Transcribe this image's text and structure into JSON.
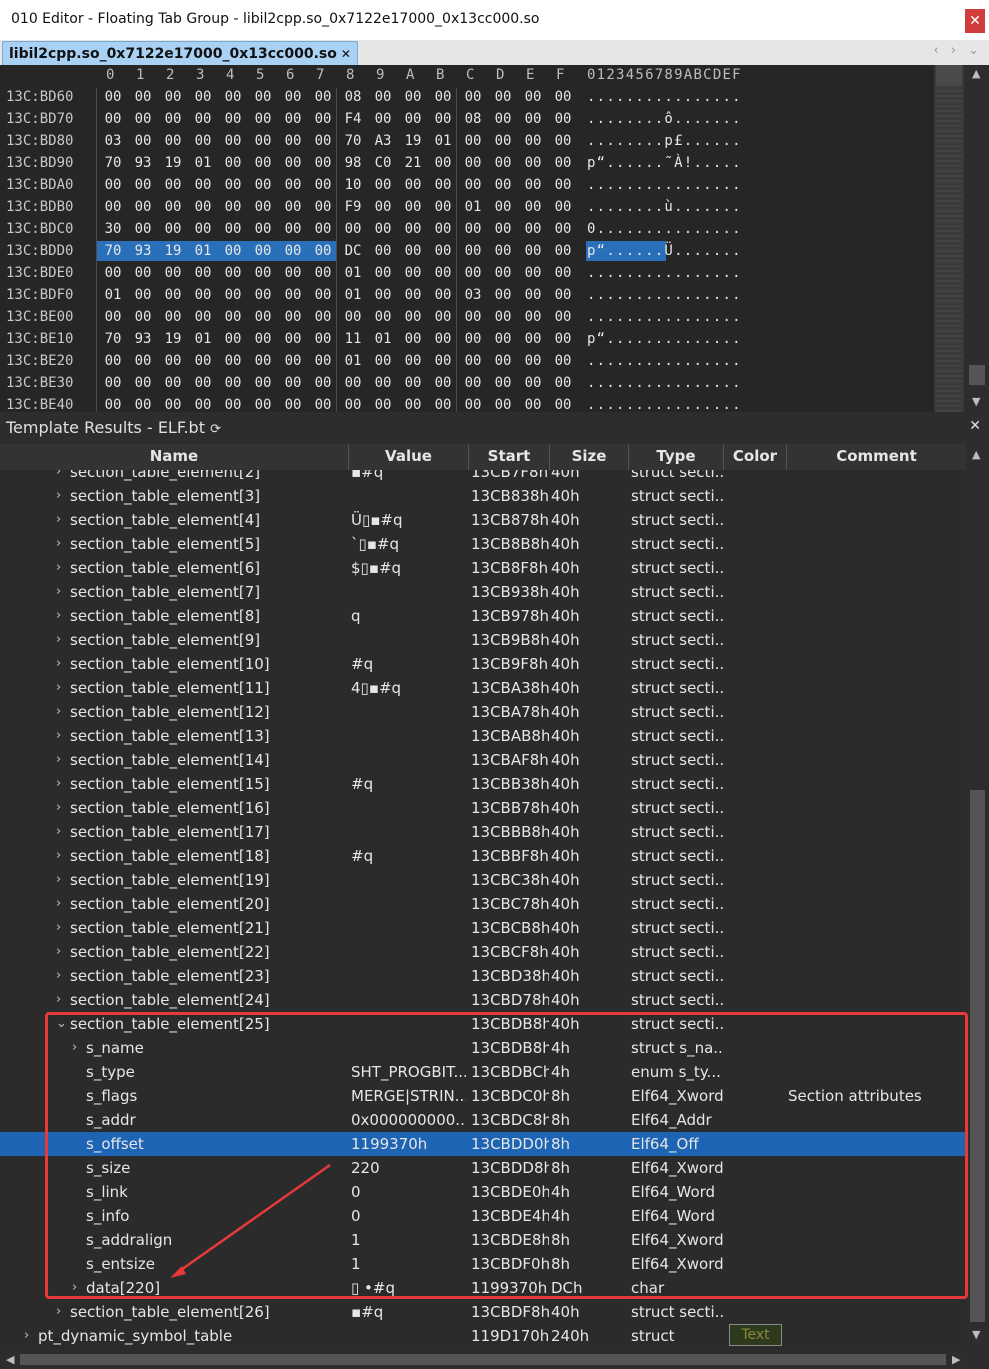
{
  "window": {
    "title": "010 Editor - Floating Tab Group - libil2cpp.so_0x7122e17000_0x13cc000.so",
    "close_glyph": "✕"
  },
  "tabs": [
    {
      "label": "libil2cpp.so_0x7122e17000_0x13cc000.so",
      "close": "✕"
    }
  ],
  "tab_nav": "‹ › ⌄",
  "hex": {
    "column_headers": [
      "0",
      "1",
      "2",
      "3",
      "4",
      "5",
      "6",
      "7",
      "8",
      "9",
      "A",
      "B",
      "C",
      "D",
      "E",
      "F"
    ],
    "ascii_header": "0123456789ABCDEF",
    "rows": [
      {
        "addr": "13C:BD60",
        "bytes": [
          "00",
          "00",
          "00",
          "00",
          "00",
          "00",
          "00",
          "00",
          "08",
          "00",
          "00",
          "00",
          "00",
          "00",
          "00",
          "00"
        ],
        "ascii": "................"
      },
      {
        "addr": "13C:BD70",
        "bytes": [
          "00",
          "00",
          "00",
          "00",
          "00",
          "00",
          "00",
          "00",
          "F4",
          "00",
          "00",
          "00",
          "08",
          "00",
          "00",
          "00"
        ],
        "ascii": "........ô......."
      },
      {
        "addr": "13C:BD80",
        "bytes": [
          "03",
          "00",
          "00",
          "00",
          "00",
          "00",
          "00",
          "00",
          "70",
          "A3",
          "19",
          "01",
          "00",
          "00",
          "00",
          "00"
        ],
        "ascii": "........p£......"
      },
      {
        "addr": "13C:BD90",
        "bytes": [
          "70",
          "93",
          "19",
          "01",
          "00",
          "00",
          "00",
          "00",
          "98",
          "C0",
          "21",
          "00",
          "00",
          "00",
          "00",
          "00"
        ],
        "ascii": "p“......˜À!....."
      },
      {
        "addr": "13C:BDA0",
        "bytes": [
          "00",
          "00",
          "00",
          "00",
          "00",
          "00",
          "00",
          "00",
          "10",
          "00",
          "00",
          "00",
          "00",
          "00",
          "00",
          "00"
        ],
        "ascii": "................"
      },
      {
        "addr": "13C:BDB0",
        "bytes": [
          "00",
          "00",
          "00",
          "00",
          "00",
          "00",
          "00",
          "00",
          "F9",
          "00",
          "00",
          "00",
          "01",
          "00",
          "00",
          "00"
        ],
        "ascii": "........ù......."
      },
      {
        "addr": "13C:BDC0",
        "bytes": [
          "30",
          "00",
          "00",
          "00",
          "00",
          "00",
          "00",
          "00",
          "00",
          "00",
          "00",
          "00",
          "00",
          "00",
          "00",
          "00"
        ],
        "ascii": "0..............."
      },
      {
        "addr": "13C:BDD0",
        "bytes": [
          "70",
          "93",
          "19",
          "01",
          "00",
          "00",
          "00",
          "00",
          "DC",
          "00",
          "00",
          "00",
          "00",
          "00",
          "00",
          "00"
        ],
        "ascii": "p“......Ü.......",
        "selected": true
      },
      {
        "addr": "13C:BDE0",
        "bytes": [
          "00",
          "00",
          "00",
          "00",
          "00",
          "00",
          "00",
          "00",
          "01",
          "00",
          "00",
          "00",
          "00",
          "00",
          "00",
          "00"
        ],
        "ascii": "................"
      },
      {
        "addr": "13C:BDF0",
        "bytes": [
          "01",
          "00",
          "00",
          "00",
          "00",
          "00",
          "00",
          "00",
          "01",
          "00",
          "00",
          "00",
          "03",
          "00",
          "00",
          "00"
        ],
        "ascii": "................"
      },
      {
        "addr": "13C:BE00",
        "bytes": [
          "00",
          "00",
          "00",
          "00",
          "00",
          "00",
          "00",
          "00",
          "00",
          "00",
          "00",
          "00",
          "00",
          "00",
          "00",
          "00"
        ],
        "ascii": "................"
      },
      {
        "addr": "13C:BE10",
        "bytes": [
          "70",
          "93",
          "19",
          "01",
          "00",
          "00",
          "00",
          "00",
          "11",
          "01",
          "00",
          "00",
          "00",
          "00",
          "00",
          "00"
        ],
        "ascii": "p“.............."
      },
      {
        "addr": "13C:BE20",
        "bytes": [
          "00",
          "00",
          "00",
          "00",
          "00",
          "00",
          "00",
          "00",
          "01",
          "00",
          "00",
          "00",
          "00",
          "00",
          "00",
          "00"
        ],
        "ascii": "................"
      },
      {
        "addr": "13C:BE30",
        "bytes": [
          "00",
          "00",
          "00",
          "00",
          "00",
          "00",
          "00",
          "00",
          "00",
          "00",
          "00",
          "00",
          "00",
          "00",
          "00",
          "00"
        ],
        "ascii": "................"
      },
      {
        "addr": "13C:BE40",
        "bytes": [
          "00",
          "00",
          "00",
          "00",
          "00",
          "00",
          "00",
          "00",
          "00",
          "00",
          "00",
          "00",
          "00",
          "00",
          "00",
          "00"
        ],
        "ascii": "................"
      }
    ]
  },
  "template": {
    "title": "Template Results - ELF.bt",
    "refresh_glyph": "⟳",
    "close_glyph": "✕",
    "columns": [
      "Name",
      "Value",
      "Start",
      "Size",
      "Type",
      "Color",
      "Comment"
    ],
    "rows": [
      {
        "indent": 1,
        "expand": "›",
        "name": "section_table_element[2]",
        "value": "▪#q",
        "start": "13CB7F8h",
        "size": "40h",
        "type": "struct secti...",
        "comment": ""
      },
      {
        "indent": 1,
        "expand": "›",
        "name": "section_table_element[3]",
        "value": "",
        "start": "13CB838h",
        "size": "40h",
        "type": "struct secti...",
        "comment": ""
      },
      {
        "indent": 1,
        "expand": "›",
        "name": "section_table_element[4]",
        "value": "Ü▯▪#q",
        "start": "13CB878h",
        "size": "40h",
        "type": "struct secti...",
        "comment": ""
      },
      {
        "indent": 1,
        "expand": "›",
        "name": "section_table_element[5]",
        "value": "ˋ▯▪#q",
        "start": "13CB8B8h",
        "size": "40h",
        "type": "struct secti...",
        "comment": ""
      },
      {
        "indent": 1,
        "expand": "›",
        "name": "section_table_element[6]",
        "value": "$▯▪#q",
        "start": "13CB8F8h",
        "size": "40h",
        "type": "struct secti...",
        "comment": ""
      },
      {
        "indent": 1,
        "expand": "›",
        "name": "section_table_element[7]",
        "value": "",
        "start": "13CB938h",
        "size": "40h",
        "type": "struct secti...",
        "comment": ""
      },
      {
        "indent": 1,
        "expand": "›",
        "name": "section_table_element[8]",
        "value": "q",
        "start": "13CB978h",
        "size": "40h",
        "type": "struct secti...",
        "comment": ""
      },
      {
        "indent": 1,
        "expand": "›",
        "name": "section_table_element[9]",
        "value": "",
        "start": "13CB9B8h",
        "size": "40h",
        "type": "struct secti...",
        "comment": ""
      },
      {
        "indent": 1,
        "expand": "›",
        "name": "section_table_element[10]",
        "value": "#q",
        "start": "13CB9F8h",
        "size": "40h",
        "type": "struct secti...",
        "comment": ""
      },
      {
        "indent": 1,
        "expand": "›",
        "name": "section_table_element[11]",
        "value": "4▯▪#q",
        "start": "13CBA38h",
        "size": "40h",
        "type": "struct secti...",
        "comment": ""
      },
      {
        "indent": 1,
        "expand": "›",
        "name": "section_table_element[12]",
        "value": "",
        "start": "13CBA78h",
        "size": "40h",
        "type": "struct secti...",
        "comment": ""
      },
      {
        "indent": 1,
        "expand": "›",
        "name": "section_table_element[13]",
        "value": "",
        "start": "13CBAB8h",
        "size": "40h",
        "type": "struct secti...",
        "comment": ""
      },
      {
        "indent": 1,
        "expand": "›",
        "name": "section_table_element[14]",
        "value": "",
        "start": "13CBAF8h",
        "size": "40h",
        "type": "struct secti...",
        "comment": ""
      },
      {
        "indent": 1,
        "expand": "›",
        "name": "section_table_element[15]",
        "value": "#q",
        "start": "13CBB38h",
        "size": "40h",
        "type": "struct secti...",
        "comment": ""
      },
      {
        "indent": 1,
        "expand": "›",
        "name": "section_table_element[16]",
        "value": "",
        "start": "13CBB78h",
        "size": "40h",
        "type": "struct secti...",
        "comment": ""
      },
      {
        "indent": 1,
        "expand": "›",
        "name": "section_table_element[17]",
        "value": "",
        "start": "13CBBB8h",
        "size": "40h",
        "type": "struct secti...",
        "comment": ""
      },
      {
        "indent": 1,
        "expand": "›",
        "name": "section_table_element[18]",
        "value": "#q",
        "start": "13CBBF8h",
        "size": "40h",
        "type": "struct secti...",
        "comment": ""
      },
      {
        "indent": 1,
        "expand": "›",
        "name": "section_table_element[19]",
        "value": "",
        "start": "13CBC38h",
        "size": "40h",
        "type": "struct secti...",
        "comment": ""
      },
      {
        "indent": 1,
        "expand": "›",
        "name": "section_table_element[20]",
        "value": "",
        "start": "13CBC78h",
        "size": "40h",
        "type": "struct secti...",
        "comment": ""
      },
      {
        "indent": 1,
        "expand": "›",
        "name": "section_table_element[21]",
        "value": "",
        "start": "13CBCB8h",
        "size": "40h",
        "type": "struct secti...",
        "comment": ""
      },
      {
        "indent": 1,
        "expand": "›",
        "name": "section_table_element[22]",
        "value": "",
        "start": "13CBCF8h",
        "size": "40h",
        "type": "struct secti...",
        "comment": ""
      },
      {
        "indent": 1,
        "expand": "›",
        "name": "section_table_element[23]",
        "value": "",
        "start": "13CBD38h",
        "size": "40h",
        "type": "struct secti...",
        "comment": ""
      },
      {
        "indent": 1,
        "expand": "›",
        "name": "section_table_element[24]",
        "value": "",
        "start": "13CBD78h",
        "size": "40h",
        "type": "struct secti...",
        "comment": ""
      },
      {
        "indent": 1,
        "expand": "⌄",
        "name": "section_table_element[25]",
        "value": "",
        "start": "13CBDB8h",
        "size": "40h",
        "type": "struct secti...",
        "comment": ""
      },
      {
        "indent": 2,
        "expand": "›",
        "name": "s_name",
        "value": "",
        "start": "13CBDB8h",
        "size": "4h",
        "type": "struct s_na...",
        "comment": ""
      },
      {
        "indent": 2,
        "expand": "",
        "name": "s_type",
        "value": "SHT_PROGBIT...",
        "start": "13CBDBCh",
        "size": "4h",
        "type": "enum s_ty...",
        "comment": ""
      },
      {
        "indent": 2,
        "expand": "",
        "name": "s_flags",
        "value": "MERGE|STRIN...",
        "start": "13CBDC0h",
        "size": "8h",
        "type": "Elf64_Xword",
        "comment": "Section attributes"
      },
      {
        "indent": 2,
        "expand": "",
        "name": "s_addr",
        "value": "0x000000000...",
        "start": "13CBDC8h",
        "size": "8h",
        "type": "Elf64_Addr",
        "comment": ""
      },
      {
        "indent": 2,
        "expand": "",
        "name": "s_offset",
        "value": "1199370h",
        "start": "13CBDD0h",
        "size": "8h",
        "type": "Elf64_Off",
        "comment": "",
        "selected": true
      },
      {
        "indent": 2,
        "expand": "",
        "name": "s_size",
        "value": "220",
        "start": "13CBDD8h",
        "size": "8h",
        "type": "Elf64_Xword",
        "comment": ""
      },
      {
        "indent": 2,
        "expand": "",
        "name": "s_link",
        "value": "0",
        "start": "13CBDE0h",
        "size": "4h",
        "type": "Elf64_Word",
        "comment": ""
      },
      {
        "indent": 2,
        "expand": "",
        "name": "s_info",
        "value": "0",
        "start": "13CBDE4h",
        "size": "4h",
        "type": "Elf64_Word",
        "comment": ""
      },
      {
        "indent": 2,
        "expand": "",
        "name": "s_addralign",
        "value": "1",
        "start": "13CBDE8h",
        "size": "8h",
        "type": "Elf64_Xword",
        "comment": ""
      },
      {
        "indent": 2,
        "expand": "",
        "name": "s_entsize",
        "value": "1",
        "start": "13CBDF0h",
        "size": "8h",
        "type": "Elf64_Xword",
        "comment": ""
      },
      {
        "indent": 2,
        "expand": "›",
        "name": "data[220]",
        "value": "▯ •#q",
        "start": "1199370h",
        "size": "DCh",
        "type": "char",
        "comment": ""
      },
      {
        "indent": 1,
        "expand": "›",
        "name": "section_table_element[26]",
        "value": "▪#q",
        "start": "13CBDF8h",
        "size": "40h",
        "type": "struct secti...",
        "comment": ""
      },
      {
        "indent": 0,
        "expand": "›",
        "name": "pt_dynamic_symbol_table",
        "value": "",
        "start": "119D170h",
        "size": "240h",
        "type": "struct",
        "comment": ""
      }
    ],
    "color_button": "Text"
  },
  "colors": {
    "selection": "#1e64b4",
    "annotation": "#e63939"
  }
}
